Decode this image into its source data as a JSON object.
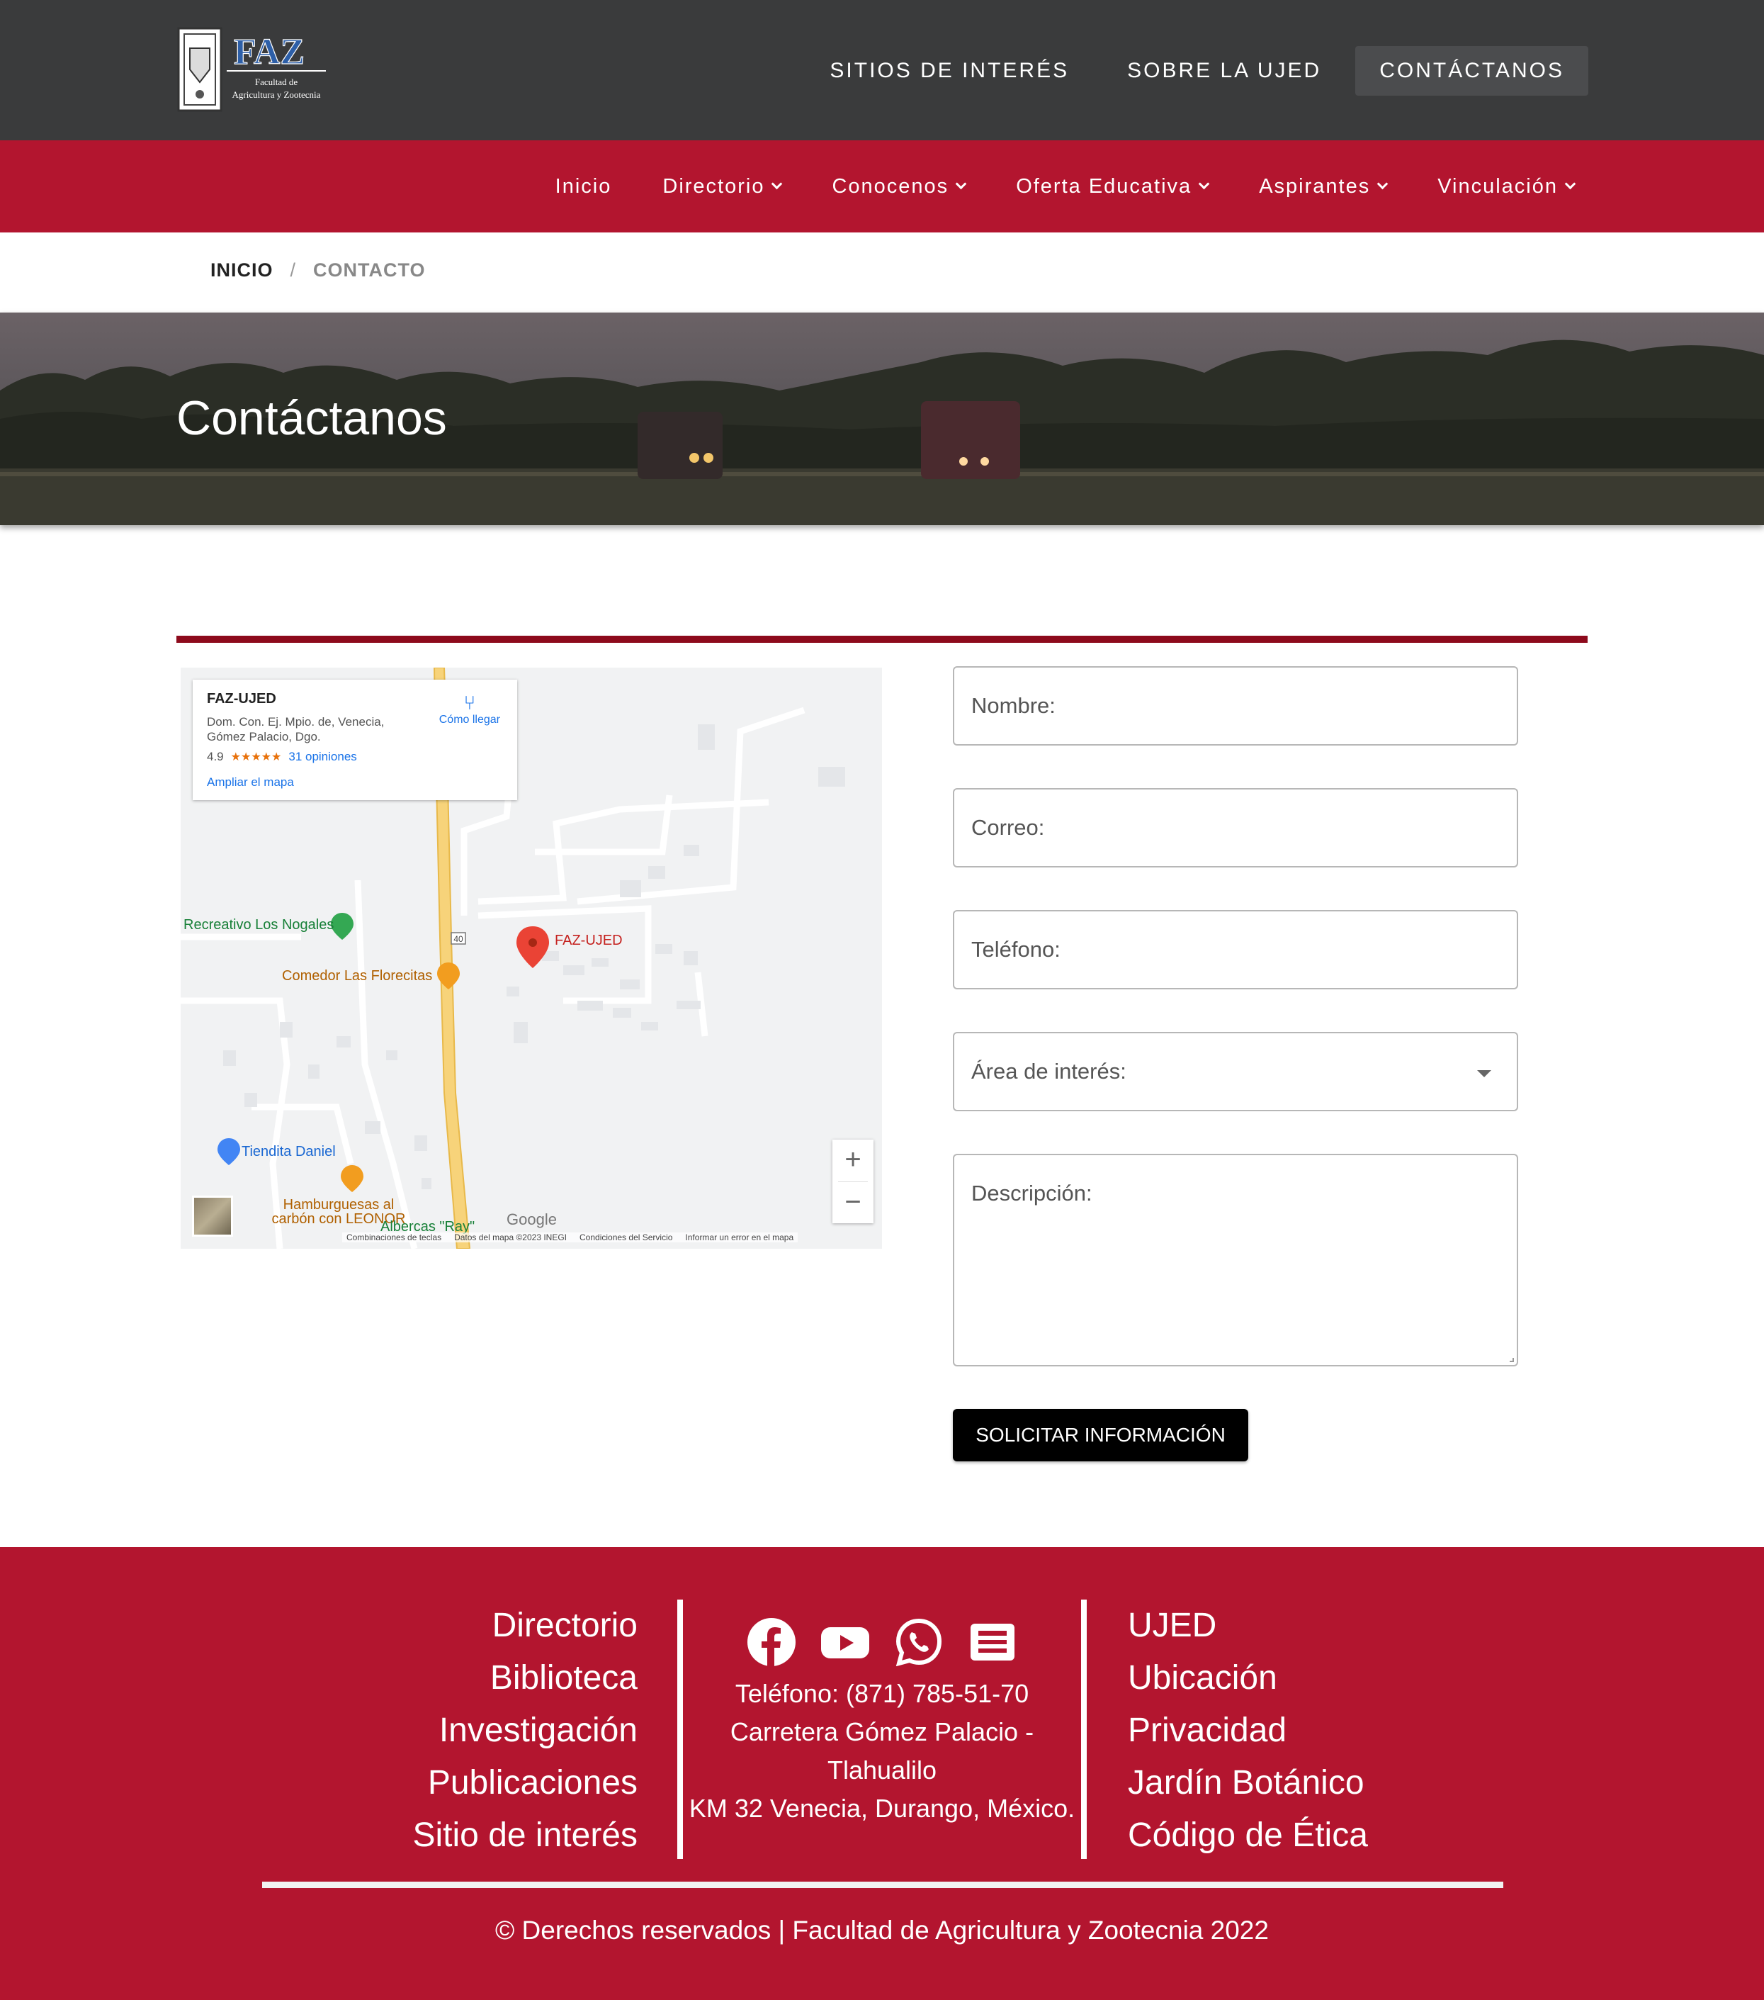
{
  "brand": {
    "logo_text": "FAZ",
    "logo_subtitle": "Facultad de Agricultura y Zootecnia"
  },
  "topnav": [
    {
      "label": "SITIOS DE INTERÉS"
    },
    {
      "label": "SOBRE LA UJED"
    },
    {
      "label": "CONTÁCTANOS",
      "active": true
    }
  ],
  "mainnav": [
    {
      "label": "Inicio",
      "dropdown": false
    },
    {
      "label": "Directorio",
      "dropdown": true
    },
    {
      "label": "Conocenos",
      "dropdown": true
    },
    {
      "label": "Oferta Educativa",
      "dropdown": true
    },
    {
      "label": "Aspirantes",
      "dropdown": true
    },
    {
      "label": "Vinculación",
      "dropdown": true
    }
  ],
  "breadcrumb": {
    "home": "INICIO",
    "separator": "/",
    "current": "CONTACTO"
  },
  "banner": {
    "title": "Contáctanos"
  },
  "map": {
    "place_name": "FAZ-UJED",
    "address_line1": "Dom. Con. Ej. Mpio. de, Venecia,",
    "address_line2": "Gómez Palacio, Dgo.",
    "rating": "4.9",
    "stars": "★★★★★",
    "reviews": "31 opiniones",
    "expand": "Ampliar el mapa",
    "directions": "Cómo llegar",
    "marker_label": "FAZ-UJED",
    "pois": {
      "nogales": "Recreativo Los Nogales",
      "florecitas": "Comedor Las Florecitas",
      "tiendita": "Tiendita Daniel",
      "hamburguesas1": "Hamburguesas al",
      "hamburguesas2": "carbón con LEONOR",
      "albercas": "Albercas \"Ray\"",
      "road": "40"
    },
    "google": "Google",
    "footer": [
      "Combinaciones de teclas",
      "Datos del mapa ©2023 INEGI",
      "Condiciones del Servicio",
      "Informar un error en el mapa"
    ]
  },
  "form": {
    "name_placeholder": "Nombre:",
    "email_placeholder": "Correo:",
    "phone_placeholder": "Teléfono:",
    "area_placeholder": "Área de interés:",
    "description_placeholder": "Descripción:",
    "submit_label": "SOLICITAR INFORMACIÓN"
  },
  "footer": {
    "left_links": [
      "Directorio",
      "Biblioteca",
      "Investigación",
      "Publicaciones",
      "Sitio de interés"
    ],
    "social_icons": [
      "facebook-icon",
      "youtube-icon",
      "whatsapp-icon",
      "newspaper-icon"
    ],
    "phone": "Teléfono: (871) 785-51-70",
    "address_line1": "Carretera Gómez Palacio - Tlahualilo",
    "address_line2": "KM 32 Venecia, Durango, México.",
    "right_links": [
      "UJED",
      "Ubicación",
      "Privacidad",
      "Jardín Botánico",
      "Código de Ética"
    ],
    "copyright": "© Derechos reservados | Facultad de Agricultura y Zootecnia 2022"
  },
  "colors": {
    "topbar": "#3a3b3c",
    "brand_red": "#b3152f",
    "divider": "#8d0a1c",
    "button": "#000000"
  }
}
